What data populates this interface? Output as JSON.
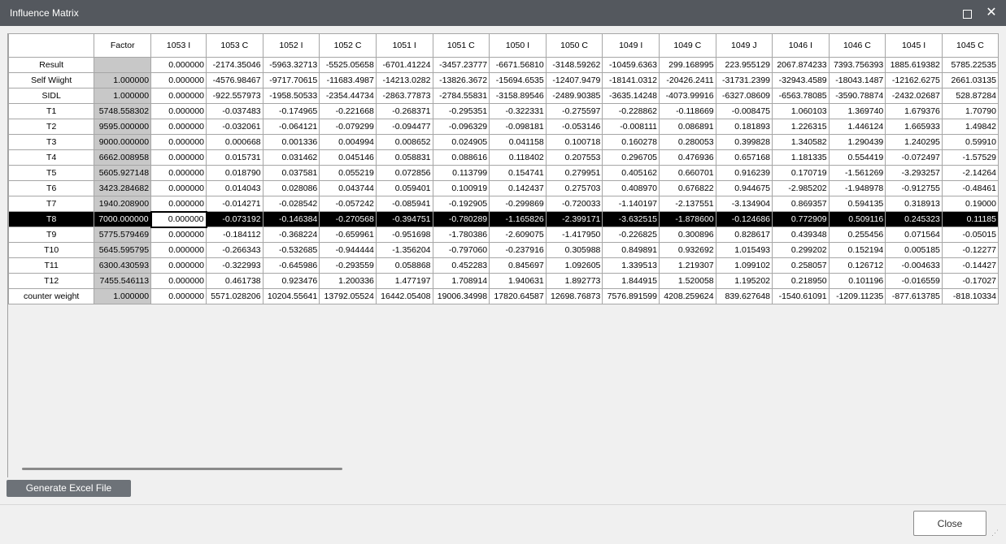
{
  "window": {
    "title": "Influence Matrix",
    "maximize_icon": "maximize-icon",
    "close_icon": "close-x-icon"
  },
  "table": {
    "headers": [
      "",
      "Factor",
      "1053 I",
      "1053 C",
      "1052 I",
      "1052 C",
      "1051 I",
      "1051 C",
      "1050 I",
      "1050 C",
      "1049 I",
      "1049 C",
      "1049 J",
      "1046 I",
      "1046 C",
      "1045 I",
      "1045 C"
    ],
    "rows": [
      {
        "label": "Result",
        "factor": "",
        "values": [
          "0.000000",
          "-2174.35046",
          "-5963.32713",
          "-5525.05658",
          "-6701.41224",
          "-3457.23777",
          "-6671.56810",
          "-3148.59262",
          "-10459.6363",
          "299.168995",
          "223.955129",
          "2067.874233",
          "7393.756393",
          "1885.619382",
          "5785.22535"
        ]
      },
      {
        "label": "Self Wiight",
        "factor": "1.000000",
        "values": [
          "0.000000",
          "-4576.98467",
          "-9717.70615",
          "-11683.4987",
          "-14213.0282",
          "-13826.3672",
          "-15694.6535",
          "-12407.9479",
          "-18141.0312",
          "-20426.2411",
          "-31731.2399",
          "-32943.4589",
          "-18043.1487",
          "-12162.6275",
          "2661.03135"
        ]
      },
      {
        "label": "SIDL",
        "factor": "1.000000",
        "values": [
          "0.000000",
          "-922.557973",
          "-1958.50533",
          "-2354.44734",
          "-2863.77873",
          "-2784.55831",
          "-3158.89546",
          "-2489.90385",
          "-3635.14248",
          "-4073.99916",
          "-6327.08609",
          "-6563.78085",
          "-3590.78874",
          "-2432.02687",
          "528.87284"
        ]
      },
      {
        "label": "T1",
        "factor": "5748.558302",
        "values": [
          "0.000000",
          "-0.037483",
          "-0.174965",
          "-0.221668",
          "-0.268371",
          "-0.295351",
          "-0.322331",
          "-0.275597",
          "-0.228862",
          "-0.118669",
          "-0.008475",
          "1.060103",
          "1.369740",
          "1.679376",
          "1.70790"
        ]
      },
      {
        "label": "T2",
        "factor": "9595.000000",
        "values": [
          "0.000000",
          "-0.032061",
          "-0.064121",
          "-0.079299",
          "-0.094477",
          "-0.096329",
          "-0.098181",
          "-0.053146",
          "-0.008111",
          "0.086891",
          "0.181893",
          "1.226315",
          "1.446124",
          "1.665933",
          "1.49842"
        ]
      },
      {
        "label": "T3",
        "factor": "9000.000000",
        "values": [
          "0.000000",
          "0.000668",
          "0.001336",
          "0.004994",
          "0.008652",
          "0.024905",
          "0.041158",
          "0.100718",
          "0.160278",
          "0.280053",
          "0.399828",
          "1.340582",
          "1.290439",
          "1.240295",
          "0.59910"
        ]
      },
      {
        "label": "T4",
        "factor": "6662.008958",
        "values": [
          "0.000000",
          "0.015731",
          "0.031462",
          "0.045146",
          "0.058831",
          "0.088616",
          "0.118402",
          "0.207553",
          "0.296705",
          "0.476936",
          "0.657168",
          "1.181335",
          "0.554419",
          "-0.072497",
          "-1.57529"
        ]
      },
      {
        "label": "T5",
        "factor": "5605.927148",
        "values": [
          "0.000000",
          "0.018790",
          "0.037581",
          "0.055219",
          "0.072856",
          "0.113799",
          "0.154741",
          "0.279951",
          "0.405162",
          "0.660701",
          "0.916239",
          "0.170719",
          "-1.561269",
          "-3.293257",
          "-2.14264"
        ]
      },
      {
        "label": "T6",
        "factor": "3423.284682",
        "values": [
          "0.000000",
          "0.014043",
          "0.028086",
          "0.043744",
          "0.059401",
          "0.100919",
          "0.142437",
          "0.275703",
          "0.408970",
          "0.676822",
          "0.944675",
          "-2.985202",
          "-1.948978",
          "-0.912755",
          "-0.48461"
        ]
      },
      {
        "label": "T7",
        "factor": "1940.208900",
        "values": [
          "0.000000",
          "-0.014271",
          "-0.028542",
          "-0.057242",
          "-0.085941",
          "-0.192905",
          "-0.299869",
          "-0.720033",
          "-1.140197",
          "-2.137551",
          "-3.134904",
          "0.869357",
          "0.594135",
          "0.318913",
          "0.19000"
        ]
      },
      {
        "label": "T8",
        "factor": "7000.000000",
        "values": [
          "0.000000",
          "-0.073192",
          "-0.146384",
          "-0.270568",
          "-0.394751",
          "-0.780289",
          "-1.165826",
          "-2.399171",
          "-3.632515",
          "-1.878600",
          "-0.124686",
          "0.772909",
          "0.509116",
          "0.245323",
          "0.11185"
        ]
      },
      {
        "label": "T9",
        "factor": "5775.579469",
        "values": [
          "0.000000",
          "-0.184112",
          "-0.368224",
          "-0.659961",
          "-0.951698",
          "-1.780386",
          "-2.609075",
          "-1.417950",
          "-0.226825",
          "0.300896",
          "0.828617",
          "0.439348",
          "0.255456",
          "0.071564",
          "-0.05015"
        ]
      },
      {
        "label": "T10",
        "factor": "5645.595795",
        "values": [
          "0.000000",
          "-0.266343",
          "-0.532685",
          "-0.944444",
          "-1.356204",
          "-0.797060",
          "-0.237916",
          "0.305988",
          "0.849891",
          "0.932692",
          "1.015493",
          "0.299202",
          "0.152194",
          "0.005185",
          "-0.12277"
        ]
      },
      {
        "label": "T11",
        "factor": "6300.430593",
        "values": [
          "0.000000",
          "-0.322993",
          "-0.645986",
          "-0.293559",
          "0.058868",
          "0.452283",
          "0.845697",
          "1.092605",
          "1.339513",
          "1.219307",
          "1.099102",
          "0.258057",
          "0.126712",
          "-0.004633",
          "-0.14427"
        ]
      },
      {
        "label": "T12",
        "factor": "7455.546113",
        "values": [
          "0.000000",
          "0.461738",
          "0.923476",
          "1.200336",
          "1.477197",
          "1.708914",
          "1.940631",
          "1.892773",
          "1.844915",
          "1.520058",
          "1.195202",
          "0.218950",
          "0.101196",
          "-0.016559",
          "-0.17027"
        ]
      },
      {
        "label": "counter weight",
        "factor": "1.000000",
        "values": [
          "0.000000",
          "5571.028206",
          "10204.55641",
          "13792.05524",
          "16442.05408",
          "19006.34998",
          "17820.64587",
          "12698.76873",
          "7576.891599",
          "4208.259624",
          "839.627648",
          "-1540.61091",
          "-1209.11235",
          "-877.613785",
          "-818.10334"
        ]
      }
    ],
    "selected_row": "T8"
  },
  "buttons": {
    "generate_excel": "Generate Excel File",
    "close": "Close"
  }
}
